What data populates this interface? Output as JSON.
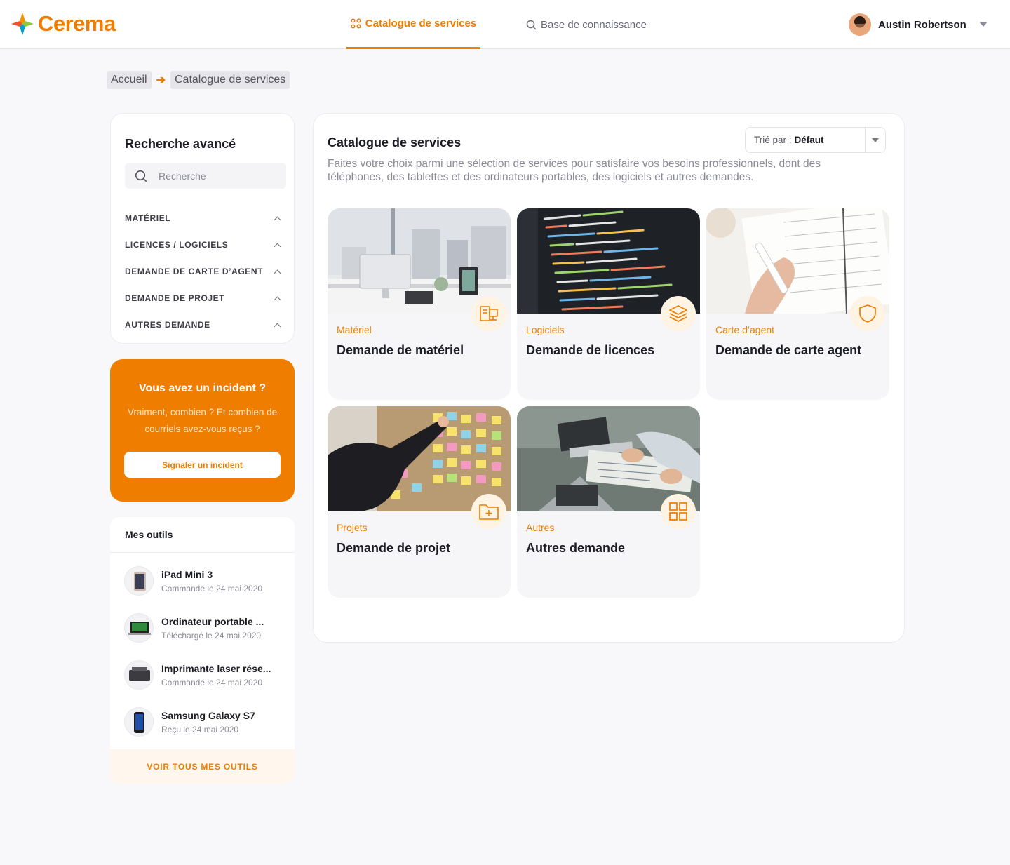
{
  "brand": {
    "name": "Cerema",
    "accent": "#ee7d00"
  },
  "nav": {
    "tabs": [
      {
        "label": "Catalogue de services",
        "icon": "grid-icon",
        "active": true
      },
      {
        "label": "Base de connaissance",
        "icon": "search-icon",
        "active": false
      }
    ]
  },
  "user": {
    "name": "Austin Robertson"
  },
  "breadcrumb": {
    "items": [
      "Accueil",
      "Catalogue de services"
    ]
  },
  "search_panel": {
    "title": "Recherche avancé",
    "placeholder": "Recherche",
    "categories": [
      "MATÉRIEL",
      "LICENCES / LOGICIELS",
      "DEMANDE DE CARTE D’AGENT",
      "DEMANDE DE PROJET",
      "AUTRES DEMANDE"
    ]
  },
  "incident": {
    "title": "Vous avez un incident ?",
    "text": "Vraiment, combien ? Et combien de courriels avez-vous reçus ?",
    "button": "Signaler un incident"
  },
  "tools": {
    "title": "Mes outils",
    "items": [
      {
        "name": "iPad Mini 3",
        "date": "Commandé le 24 mai 2020"
      },
      {
        "name": "Ordinateur portable ...",
        "date": "Téléchargé le 24 mai 2020"
      },
      {
        "name": "Imprimante laser rése...",
        "date": "Commandé le 24 mai 2020"
      },
      {
        "name": "Samsung Galaxy S7",
        "date": "Reçu le 24 mai 2020"
      }
    ],
    "footer": "VOIR TOUS MES OUTILS"
  },
  "catalog": {
    "title": "Catalogue de services",
    "intro": "Faites votre choix parmi une sélection de services pour satisfaire vos besoins professionnels, dont des téléphones, des tablettes et des ordinateurs portables, des logiciels et autres demandes.",
    "sort_label": "Trié par :",
    "sort_value": "Défaut",
    "cards": [
      {
        "category": "Matériel",
        "title": "Demande de matériel",
        "icon": "hardware-icon"
      },
      {
        "category": "Logiciels",
        "title": "Demande de licences",
        "icon": "layers-icon"
      },
      {
        "category": "Carte d’agent",
        "title": "Demande de carte agent",
        "icon": "shield-icon"
      },
      {
        "category": "Projets",
        "title": "Demande de projet",
        "icon": "folder-plus-icon"
      },
      {
        "category": "Autres",
        "title": "Autres demande",
        "icon": "grid-icon"
      }
    ]
  }
}
